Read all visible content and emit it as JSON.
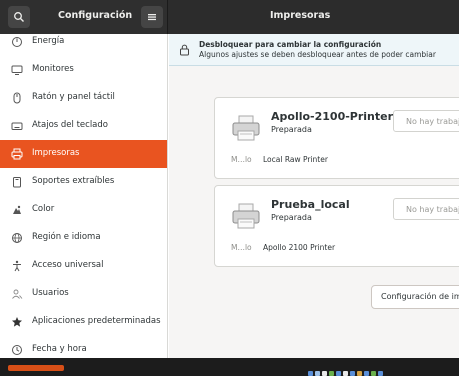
{
  "header": {
    "left_title": "Configuración",
    "right_title": "Impresoras"
  },
  "sidebar": {
    "items": [
      {
        "label": "Energía",
        "icon": "power-icon"
      },
      {
        "label": "Monitores",
        "icon": "monitor-icon"
      },
      {
        "label": "Ratón y panel táctil",
        "icon": "mouse-icon"
      },
      {
        "label": "Atajos del teclado",
        "icon": "keyboard-icon"
      },
      {
        "label": "Impresoras",
        "icon": "printer-icon",
        "active": true
      },
      {
        "label": "Soportes extraíbles",
        "icon": "removable-media-icon"
      },
      {
        "label": "Color",
        "icon": "color-icon"
      },
      {
        "label": "Región e idioma",
        "icon": "globe-icon"
      },
      {
        "label": "Acceso universal",
        "icon": "accessibility-icon"
      },
      {
        "label": "Usuarios",
        "icon": "users-icon"
      },
      {
        "label": "Aplicaciones predeterminadas",
        "icon": "star-icon"
      },
      {
        "label": "Fecha y hora",
        "icon": "clock-icon"
      }
    ]
  },
  "infobar": {
    "title": "Desbloquear para cambiar la configuración",
    "subtitle": "Algunos ajustes se deben desbloquear antes de poder cambiar"
  },
  "printers": [
    {
      "name": "Apollo-2100-Printer",
      "status": "Preparada",
      "jobs": "No hay trabajos",
      "model_label": "M…lo",
      "model": "Local Raw Printer"
    },
    {
      "name": "Prueba_local",
      "status": "Preparada",
      "jobs": "No hay trabajos",
      "model_label": "M…lo",
      "model": "Apollo 2100 Printer"
    }
  ],
  "config_button": "Configuración de impresión",
  "colors": {
    "accent": "#e95420",
    "headerbar": "#2c2c2c",
    "infobar": "#eef6f9"
  }
}
